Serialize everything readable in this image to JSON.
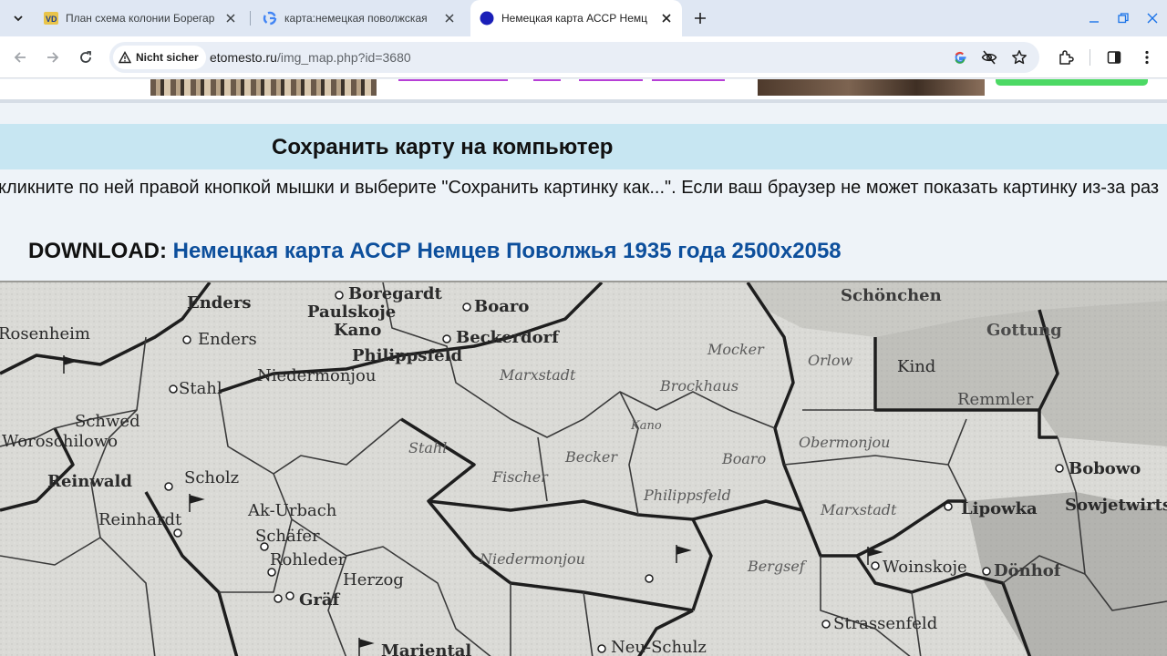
{
  "browser": {
    "tabs": [
      {
        "title": "План схема колонии Борегар",
        "active": false
      },
      {
        "title": "карта:немецкая поволжская",
        "active": false
      },
      {
        "title": "Немецкая карта АССР Немц",
        "active": true
      }
    ],
    "security_chip": "Nicht sicher",
    "url_host": "etomesto.ru",
    "url_path": "/img_map.php?id=3680",
    "icons": [
      "tab-search-icon",
      "close-icon",
      "plus-icon",
      "minimize-icon",
      "restore-icon",
      "close-window-icon",
      "back-arrow-icon",
      "forward-arrow-icon",
      "reload-icon",
      "warning-icon",
      "google-icon",
      "eye-off-icon",
      "star-icon",
      "extensions-icon",
      "side-panel-icon",
      "more-vert-icon"
    ]
  },
  "page": {
    "save_heading": "Сохранить карту на компьютер",
    "instruction": "кликните по ней правой кнопкой мышки и выберите \"Сохранить картинку как...\". Если ваш браузер не может показать картинку из-за раз",
    "download_label": "DOWNLOAD:",
    "download_link": "Немецкая карта АССР Немцев Поволжья 1935 года 2500x2058",
    "accent_color": "#0d4f9c",
    "heading_bg": "#c7e6f2"
  },
  "map": {
    "labels": [
      "Boregardt",
      "Paulskoje",
      "Kano",
      "Boaro",
      "Philippsfeld",
      "Beckerdorf",
      "Rosenheim",
      "Enders",
      "Niedermonjou",
      "Marxstadt",
      "Stahl",
      "Schwed",
      "Woroschilowo",
      "Reinwald",
      "Scholz",
      "Reinhardt",
      "Ak-Urbach",
      "Schäfer",
      "Rohleder",
      "Herzog",
      "Gräf",
      "Mariental",
      "Fischer",
      "Becker",
      "Philippsfeld",
      "Niedermonjou",
      "Brockhaus",
      "Mocker",
      "Kano",
      "Orlow",
      "Schönchen",
      "Gottung",
      "Kind",
      "Remmler",
      "Obermonjou",
      "Boaro",
      "Bobowo",
      "Sowjetwirts",
      "Lipowka",
      "Marxstadt",
      "Woinskoje",
      "Strassenfeld",
      "Neu-Schulz",
      "Bergsef",
      "Dönhof"
    ]
  }
}
